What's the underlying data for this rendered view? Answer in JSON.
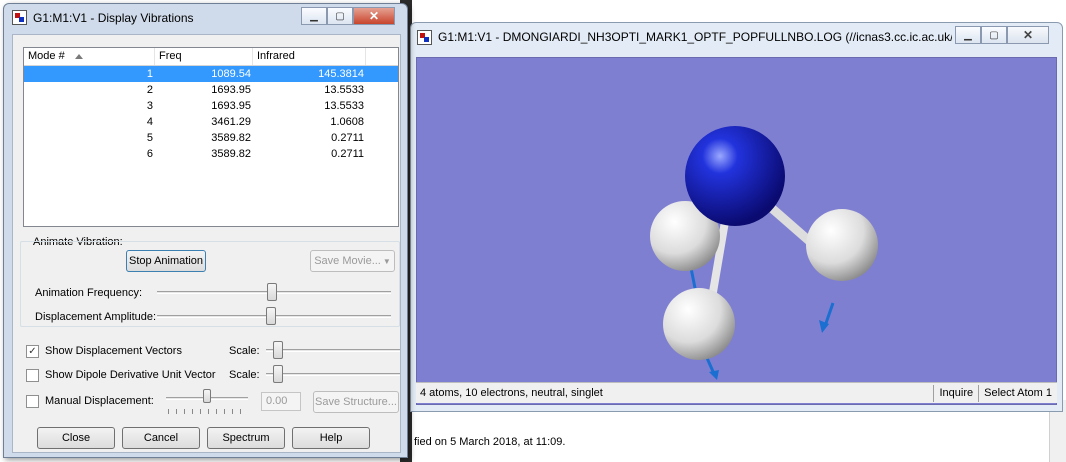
{
  "background": {
    "footer_text": "fied on 5 March 2018, at 11:09."
  },
  "viewer": {
    "title": "G1:M1:V1 - DMONGIARDI_NH3OPTI_MARK1_OPTF_POPFULLNBO.LOG (//icnas3.cc.ic.ac.uk/dm1...",
    "status": "4 atoms, 10 electrons, neutral, singlet",
    "inquire": "Inquire",
    "select_atom": "Select Atom 1",
    "viewport_color": "#7f7fd2"
  },
  "dialog": {
    "title": "G1:M1:V1 - Display Vibrations",
    "columns": {
      "mode": "Mode #",
      "freq": "Freq",
      "infrared": "Infrared"
    },
    "rows": [
      {
        "mode": "1",
        "freq": "1089.54",
        "ir": "145.3814"
      },
      {
        "mode": "2",
        "freq": "1693.95",
        "ir": "13.5533"
      },
      {
        "mode": "3",
        "freq": "1693.95",
        "ir": "13.5533"
      },
      {
        "mode": "4",
        "freq": "3461.29",
        "ir": "1.0608"
      },
      {
        "mode": "5",
        "freq": "3589.82",
        "ir": "0.2711"
      },
      {
        "mode": "6",
        "freq": "3589.82",
        "ir": "0.2711"
      }
    ],
    "selected_row": 0,
    "animate_group": "Animate Vibration:",
    "stop_animation": "Stop Animation",
    "save_movie": "Save Movie...",
    "animation_frequency": "Animation Frequency:",
    "displacement_amplitude": "Displacement Amplitude:",
    "show_disp_vectors": "Show Displacement Vectors",
    "show_disp_vectors_checked": true,
    "scale": "Scale:",
    "show_dipole": "Show Dipole Derivative Unit Vector",
    "manual_disp": "Manual Displacement:",
    "manual_value": "0.00",
    "save_structure": "Save Structure...",
    "close": "Close",
    "cancel": "Cancel",
    "spectrum": "Spectrum",
    "help": "Help"
  }
}
